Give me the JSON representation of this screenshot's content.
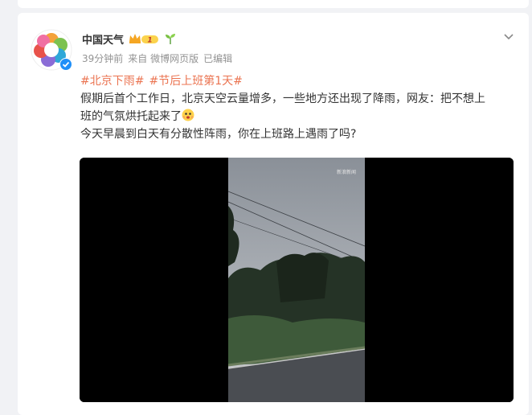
{
  "post": {
    "author": "中国天气",
    "badge_level": "1",
    "time": "39分钟前",
    "source": "来自 微博网页版",
    "edited": "已编辑",
    "tags": [
      "#北京下雨#",
      "#节后上班第1天#"
    ],
    "text_line1": "假期后首个工作日，北京天空云量增多，一些地方还出现了降雨，网友：把不想上",
    "text_line2": "班的气氛烘托起来了",
    "text_line3": "今天早晨到白天有分散性阵雨，你在上班路上遇雨了吗?",
    "video_watermark": "新浪新闻"
  },
  "icons": {
    "avatar": "china-weather-logo",
    "verified": "verified-badge-icon",
    "crown": "vip-crown-icon",
    "sprout": "sprout-icon",
    "more": "chevron-down-icon",
    "emoji": "scared-face-emoji"
  },
  "colors": {
    "tag": "#eb7350",
    "verified": "#1f8ff8",
    "meta": "#939393"
  }
}
